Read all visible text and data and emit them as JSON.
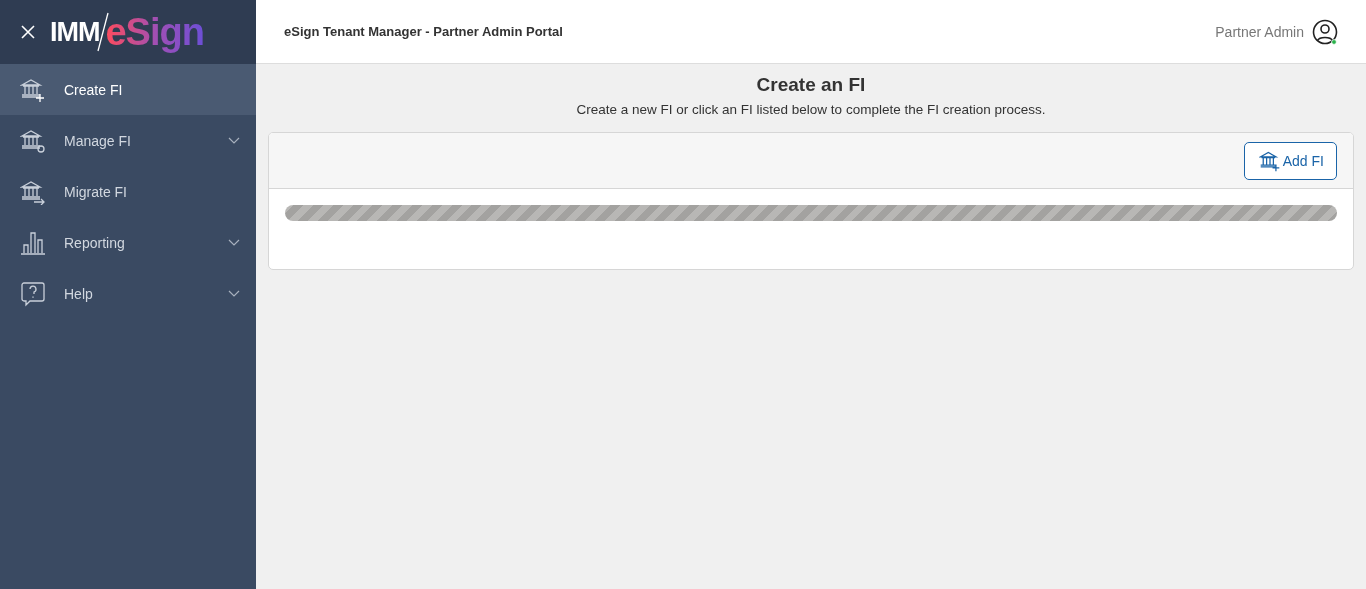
{
  "logo": {
    "part_1": "IMM",
    "part_2": "eSign"
  },
  "sidebar": {
    "items": [
      {
        "label": "Create FI",
        "selected": true,
        "expandable": false
      },
      {
        "label": "Manage FI",
        "selected": false,
        "expandable": true
      },
      {
        "label": "Migrate FI",
        "selected": false,
        "expandable": false
      },
      {
        "label": "Reporting",
        "selected": false,
        "expandable": true
      },
      {
        "label": "Help",
        "selected": false,
        "expandable": true
      }
    ]
  },
  "header": {
    "title": "eSign Tenant Manager - Partner Admin Portal",
    "user": "Partner Admin",
    "online": true
  },
  "page": {
    "title": "Create an FI",
    "subtitle": "Create a new FI or click an FI listed below to complete the FI creation process.",
    "add_button": "Add FI"
  }
}
